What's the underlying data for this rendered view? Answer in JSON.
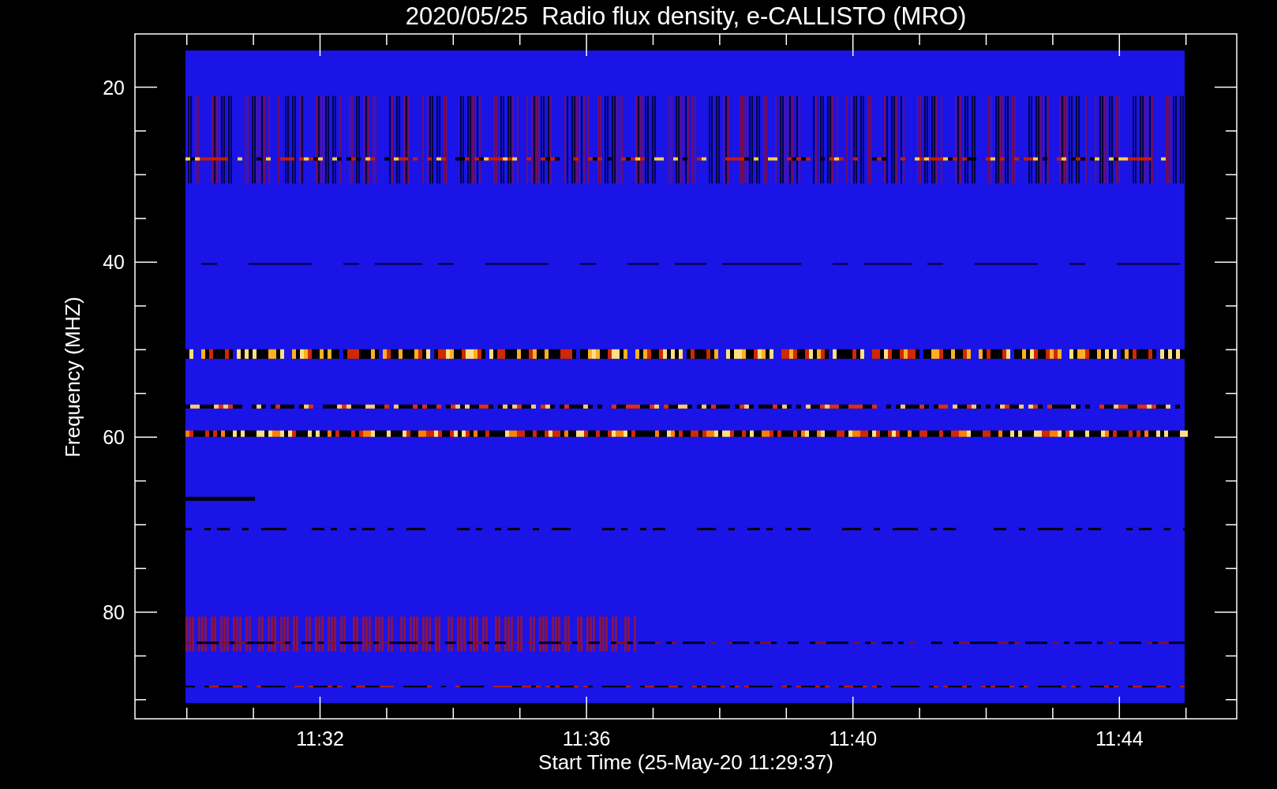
{
  "title": "2020/05/25  Radio flux density, e-CALLISTO (MRO)",
  "y_axis": {
    "label": "Frequency (MHZ)",
    "ticks": [
      "20",
      "40",
      "60",
      "80"
    ]
  },
  "x_axis": {
    "label": "Start Time (25-May-20 11:29:37)",
    "ticks": [
      "11:32",
      "11:36",
      "11:40",
      "11:44"
    ]
  }
}
